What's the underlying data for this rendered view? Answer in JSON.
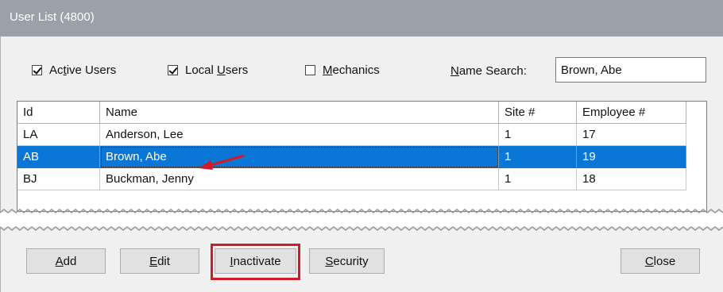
{
  "window": {
    "title": "User List (4800)"
  },
  "filters": [
    {
      "label": "Active Users",
      "checked": true
    },
    {
      "label": "Local Users",
      "checked": true
    },
    {
      "label": "Mechanics",
      "checked": false
    }
  ],
  "name_search": {
    "label": "Name Search:",
    "value": "Brown, Abe"
  },
  "grid": {
    "columns": [
      "Id",
      "Name",
      "Site #",
      "Employee #"
    ],
    "rows": [
      {
        "id": "LA",
        "name": "Anderson, Lee",
        "site": "1",
        "employee": "17",
        "selected": false
      },
      {
        "id": "AB",
        "name": "Brown, Abe",
        "site": "1",
        "employee": "19",
        "selected": true
      },
      {
        "id": "BJ",
        "name": "Buckman, Jenny",
        "site": "1",
        "employee": "18",
        "selected": false
      }
    ]
  },
  "buttons": {
    "add": "Add",
    "edit": "Edit",
    "inactivate": "Inactivate",
    "security": "Security",
    "close": "Close"
  },
  "colors": {
    "titlebar": "#9aa1a8",
    "selection": "#0a76d6",
    "annotation": "#d11a2a"
  }
}
